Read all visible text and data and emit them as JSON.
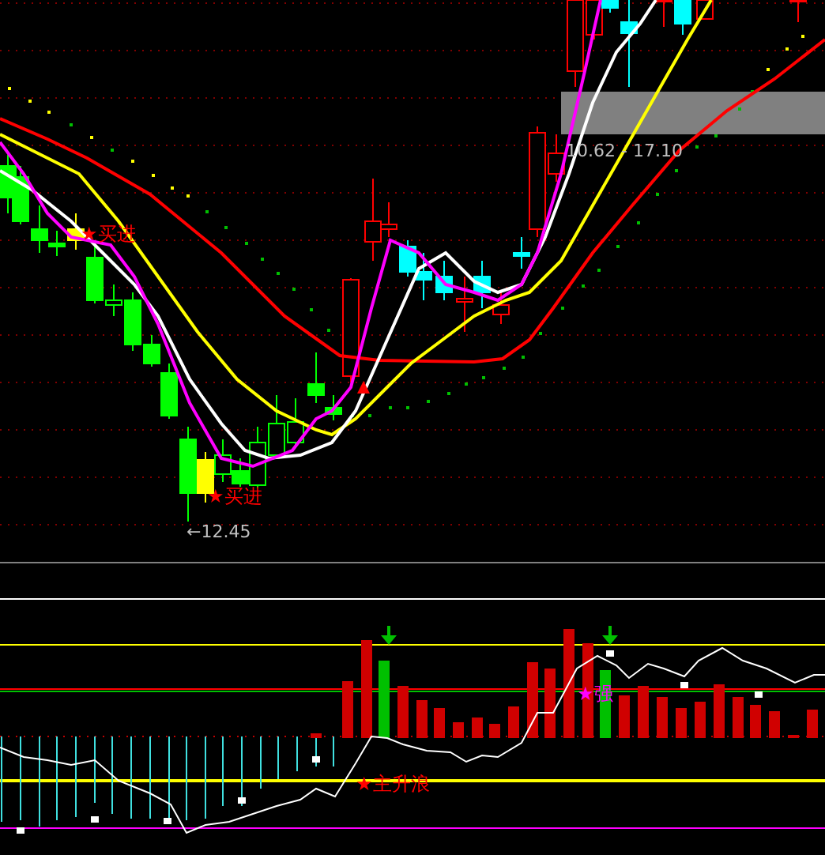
{
  "main_chart": {
    "buy_signals": [
      {
        "label": "★买进"
      },
      {
        "label": "★买进"
      }
    ],
    "low_price": "←12.45",
    "price_range": "10.62 - 17.10"
  },
  "indicator": {
    "signals": [
      {
        "label": "★强",
        "color": "#ff00ff"
      },
      {
        "label": "★主升浪",
        "color": "#ff0000"
      }
    ]
  }
}
